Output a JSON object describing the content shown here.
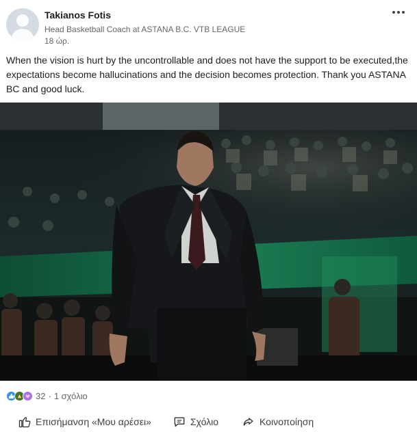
{
  "author": {
    "name": "Takianos Fotis",
    "headline": "Head Basketball Coach at ASTANA B.C. VTB LEAGUE",
    "time": "18 ώρ."
  },
  "post": {
    "text": "When the vision is hurt by the uncontrollable and does not have the support to be executed,the expectations become hallucinations and the decision becomes protection. Thank you ASTANA BC  and good luck."
  },
  "social": {
    "reaction_icons": [
      "like-icon",
      "celebrate-icon",
      "support-icon"
    ],
    "reactions_count": "32",
    "separator": "·",
    "comments": "1 σχόλιο"
  },
  "actions": {
    "like": "Επισήμανση «Μου αρέσει»",
    "comment": "Σχόλιο",
    "share": "Κοινοποίηση"
  },
  "colors": {
    "text": "#1d1d1d",
    "muted": "#666666",
    "like_blue": "#378fe9",
    "celebrate_green": "#44712e",
    "support_purple": "#a872e8"
  }
}
